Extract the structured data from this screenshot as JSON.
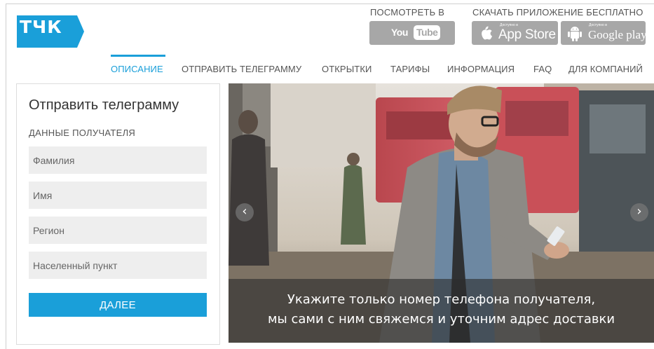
{
  "brand": {
    "logo_text": "ТЧК",
    "accent_color": "#1a9fd9"
  },
  "header": {
    "youtube_caption": "ПОСМОТРЕТЬ В",
    "apps_caption": "СКАЧАТЬ ПРИЛОЖЕНИЕ БЕСПЛАТНО",
    "youtube_you": "You",
    "youtube_tube": "Tube",
    "appstore_small": "Доступно в",
    "appstore_label": "App Store",
    "gplay_small": "Доступно в",
    "gplay_label": "Google play"
  },
  "nav": {
    "items": [
      {
        "label": "ОПИСАНИЕ",
        "active": true
      },
      {
        "label": "ОТПРАВИТЬ ТЕЛЕГРАММУ"
      },
      {
        "label": "ОТКРЫТКИ"
      },
      {
        "label": "ТАРИФЫ"
      },
      {
        "label": "ИНФОРМАЦИЯ"
      },
      {
        "label": "FAQ"
      },
      {
        "label": "ДЛЯ КОМПАНИЙ"
      }
    ]
  },
  "form": {
    "title": "Отправить телеграмму",
    "subtitle": "ДАННЫЕ ПОЛУЧАТЕЛЯ",
    "fields": [
      {
        "placeholder": "Фамилия",
        "value": ""
      },
      {
        "placeholder": "Имя",
        "value": ""
      },
      {
        "placeholder": "Регион",
        "value": ""
      },
      {
        "placeholder": "Населенный пункт",
        "value": ""
      }
    ],
    "submit_label": "ДАЛЕЕ"
  },
  "hero": {
    "caption_line1": "Укажите только номер телефона получателя,",
    "caption_line2": "мы сами с ним свяжемся и уточним адрес доставки",
    "prev_icon": "chevron-left-icon",
    "next_icon": "chevron-right-icon"
  }
}
